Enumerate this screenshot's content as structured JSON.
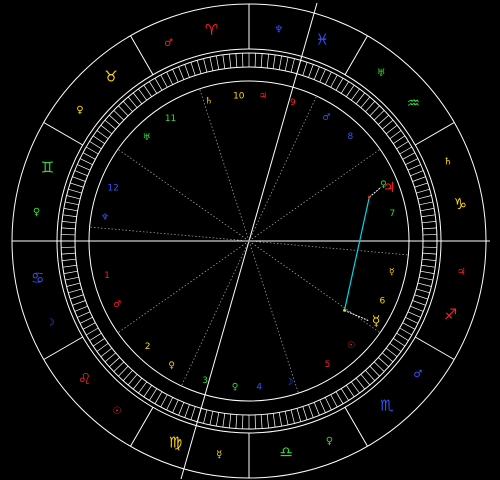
{
  "colors": {
    "background": "#000000",
    "lines": "#ffffff",
    "cusp_lines": "#9a9a9a",
    "fire": "#ff2020",
    "earth": "#ffd800",
    "air": "#33dd33",
    "water": "#3355ff",
    "aspect_opposition": "#00d8e8"
  },
  "zodiac_signs": [
    {
      "name": "cancer",
      "glyph": "♋",
      "ruler_glyph": "☽",
      "element": "water"
    },
    {
      "name": "leo",
      "glyph": "♌",
      "ruler_glyph": "☉",
      "element": "fire"
    },
    {
      "name": "virgo",
      "glyph": "♍",
      "ruler_glyph": "☿",
      "element": "earth"
    },
    {
      "name": "libra",
      "glyph": "♎",
      "ruler_glyph": "♀",
      "element": "air"
    },
    {
      "name": "scorpio",
      "glyph": "♏",
      "ruler_glyph": "♂",
      "element": "water"
    },
    {
      "name": "sagittarius",
      "glyph": "♐",
      "ruler_glyph": "♃",
      "element": "fire"
    },
    {
      "name": "capricorn",
      "glyph": "♑",
      "ruler_glyph": "♄",
      "element": "earth"
    },
    {
      "name": "aquarius",
      "glyph": "♒",
      "ruler_glyph": "♅",
      "element": "air"
    },
    {
      "name": "pisces",
      "glyph": "♓",
      "ruler_glyph": "♆",
      "element": "water"
    },
    {
      "name": "aries",
      "glyph": "♈",
      "ruler_glyph": "♂",
      "element": "fire"
    },
    {
      "name": "taurus",
      "glyph": "♉",
      "ruler_glyph": "♀",
      "element": "earth"
    },
    {
      "name": "gemini",
      "glyph": "♊",
      "ruler_glyph": "♀",
      "element": "air"
    }
  ],
  "houses": [
    {
      "number": "1",
      "glyph": "♂",
      "element": "fire"
    },
    {
      "number": "2",
      "glyph": "♀",
      "element": "earth"
    },
    {
      "number": "3",
      "glyph": "♀",
      "element": "air"
    },
    {
      "number": "4",
      "glyph": "☽",
      "element": "water"
    },
    {
      "number": "5",
      "glyph": "☉",
      "element": "fire"
    },
    {
      "number": "6",
      "glyph": "☿",
      "element": "earth"
    },
    {
      "number": "7",
      "glyph": "♀",
      "element": "air"
    },
    {
      "number": "8",
      "glyph": "♂",
      "element": "water"
    },
    {
      "number": "9",
      "glyph": "♃",
      "element": "fire"
    },
    {
      "number": "10",
      "glyph": "♄",
      "element": "earth"
    },
    {
      "number": "11",
      "glyph": "♅",
      "element": "air"
    },
    {
      "number": "12",
      "glyph": "♆",
      "element": "water"
    }
  ],
  "planets": [
    {
      "name": "jupiter",
      "glyph": "♃",
      "element": "fire"
    },
    {
      "name": "mercury",
      "glyph": "☿",
      "element": "earth"
    }
  ],
  "aspects": [
    {
      "from": "jupiter",
      "to": "mercury",
      "type": "opposition"
    }
  ]
}
